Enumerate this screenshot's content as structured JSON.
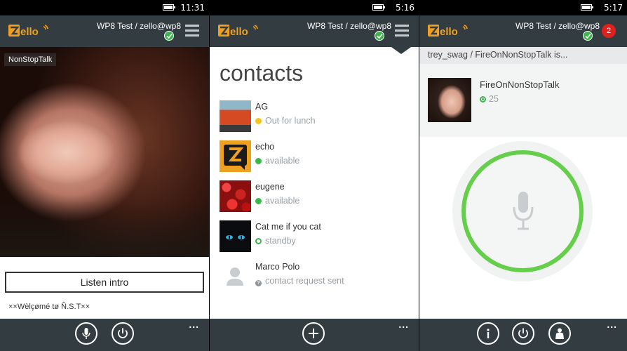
{
  "colors": {
    "appbar": "#333d41",
    "online": "#3bb64b",
    "away": "#f5c518",
    "ptt_ring": "#65cf4b",
    "badge": "#e01f1f"
  },
  "panels": [
    {
      "status_time": "11:31",
      "account": "WP8 Test / zello@wp8",
      "channel_tag": "NonStopTalk",
      "listen_intro": "Listen intro",
      "welcome_text": "××Wèlçømé tø Ñ.S.T××",
      "bottom_icons": [
        "microphone-icon",
        "power-icon"
      ],
      "more": "..."
    },
    {
      "status_time": "5:16",
      "account": "WP8 Test / zello@wp8",
      "heading": "contacts",
      "contacts": [
        {
          "name": "AG",
          "status": "Out for lunch",
          "status_icon": "away-dot-icon"
        },
        {
          "name": "echo",
          "status": "available",
          "status_icon": "online-check-icon"
        },
        {
          "name": "eugene",
          "status": "available",
          "status_icon": "online-check-icon"
        },
        {
          "name": "Cat me if you cat",
          "status": "standby",
          "status_icon": "standby-ring-icon"
        },
        {
          "name": "Marco Polo",
          "status": "contact request sent",
          "status_icon": "question-icon"
        }
      ],
      "bottom_icons": [
        "add-icon"
      ],
      "more": "..."
    },
    {
      "status_time": "5:17",
      "account": "WP8 Test / zello@wp8",
      "badge_count": "2",
      "strip_text": "trey_swag / FireOnNonStopTalk is...",
      "channel_name": "FireOnNonStopTalk",
      "channel_count": "25",
      "bottom_icons": [
        "info-icon",
        "power-icon",
        "user-icon"
      ],
      "more": "..."
    }
  ]
}
